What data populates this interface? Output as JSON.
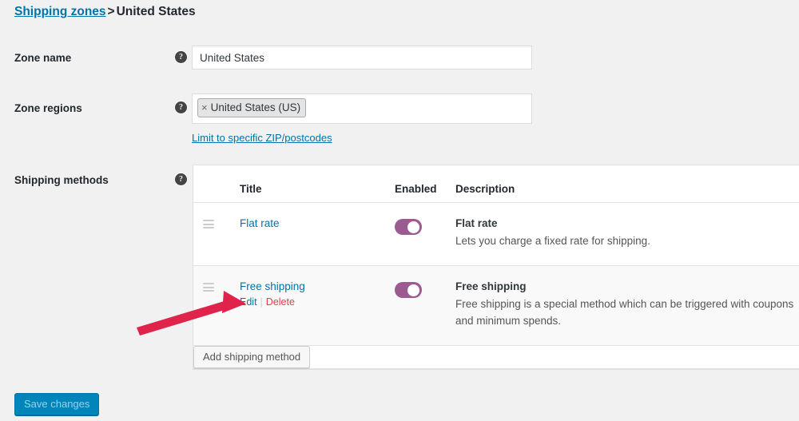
{
  "breadcrumb": {
    "parent_link": "Shipping zones",
    "separator": ">",
    "current": "United States"
  },
  "form": {
    "zone_name": {
      "label": "Zone name",
      "help_icon": "help-icon",
      "help_glyph": "?",
      "value": "United States",
      "placeholder": "Zone name"
    },
    "zone_regions": {
      "label": "Zone regions",
      "help_icon": "help-icon",
      "help_glyph": "?",
      "tags": [
        {
          "remove_glyph": "×",
          "label": "United States (US)"
        }
      ],
      "postcode_link": "Limit to specific ZIP/postcodes"
    },
    "shipping_methods": {
      "label": "Shipping methods",
      "help_icon": "help-icon",
      "help_glyph": "?"
    }
  },
  "methods_table": {
    "columns": {
      "handle": "",
      "title": "Title",
      "enabled": "Enabled",
      "description": "Description"
    },
    "rows": [
      {
        "handle_icon": "drag-handle-icon",
        "title": "Flat rate",
        "enabled": true,
        "desc_title": "Flat rate",
        "desc_body": "Lets you charge a fixed rate for shipping.",
        "actions": null
      },
      {
        "handle_icon": "drag-handle-icon",
        "title": "Free shipping",
        "enabled": true,
        "desc_title": "Free shipping",
        "desc_body": "Free shipping is a special method which can be triggered with coupons and minimum spends.",
        "actions": {
          "edit": "Edit",
          "separator": "|",
          "delete": "Delete"
        }
      }
    ],
    "add_method_button": "Add shipping method"
  },
  "footer": {
    "save_button": "Save changes"
  },
  "colors": {
    "page_background": "#f1f1f1",
    "link_blue": "#0073aa",
    "delete_red": "#f2374e",
    "toggle_on": "#9b5b91",
    "primary_button": "#0085ba",
    "annotation_arrow": "#e0234a"
  },
  "annotation": {
    "arrow_icon": "arrow-pointing-to-edit-link",
    "points_to": "Edit"
  }
}
